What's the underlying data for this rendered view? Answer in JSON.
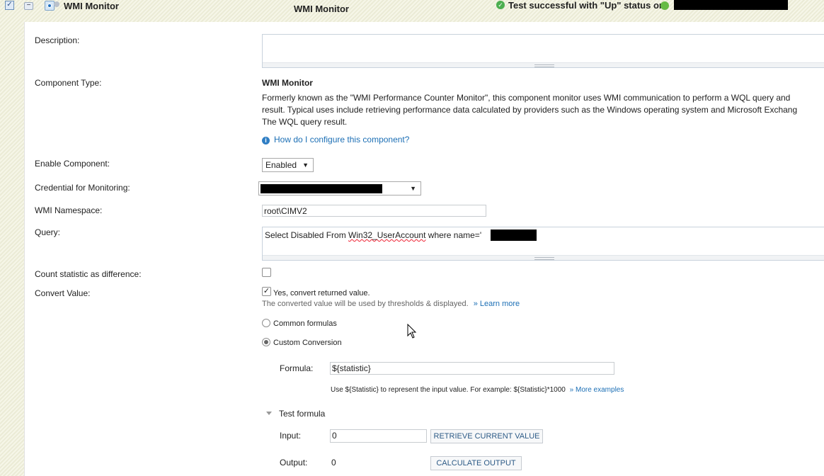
{
  "header": {
    "title": "WMI Monitor",
    "center_title": "WMI Monitor",
    "status_text": "Test successful with \"Up\" status on"
  },
  "form": {
    "description_label": "Description:",
    "description_value": "",
    "component_type_label": "Component Type:",
    "component_type_name": "WMI Monitor",
    "component_type_desc": [
      "Formerly known as the \"WMI Performance Counter Monitor\", this component monitor uses WMI communication to perform a WQL query and",
      "result. Typical uses include retrieving performance data calculated by providers such as the Windows operating system and Microsoft Exchang",
      "The WQL query result."
    ],
    "help_link": "How do I configure this component?",
    "enable_label": "Enable Component:",
    "enable_value": "Enabled",
    "credential_label": "Credential for Monitoring:",
    "namespace_label": "WMI Namespace:",
    "namespace_value": "root\\CIMV2",
    "query_label": "Query:",
    "query_prefix": "Select Disabled From ",
    "query_class": "Win32_UserAccount",
    "query_suffix": " where name='",
    "count_label": "Count statistic as difference:",
    "count_checked": false,
    "convert_label": "Convert Value:",
    "convert_checked": true,
    "convert_check_text": "Yes, convert returned value.",
    "convert_note": "The converted value will be used by thresholds & displayed.",
    "learn_more": "» Learn more",
    "common_formulas": "Common formulas",
    "custom_conversion": "Custom Conversion",
    "selected_option": "Custom Conversion",
    "formula_label": "Formula:",
    "formula_value": "${statistic}",
    "formula_hint": "Use ${Statistic} to represent the input value. For example: ${Statistic}*1000",
    "more_examples": "» More examples",
    "test_formula": "Test formula",
    "input_label": "Input:",
    "input_value": "0",
    "retrieve_button": "RETRIEVE CURRENT VALUE",
    "output_label": "Output:",
    "output_value": "0",
    "calculate_button": "CALCULATE OUTPUT"
  },
  "colors": {
    "link": "#1c6fb5",
    "success": "#4caf50",
    "button_text": "#2d5b87"
  }
}
